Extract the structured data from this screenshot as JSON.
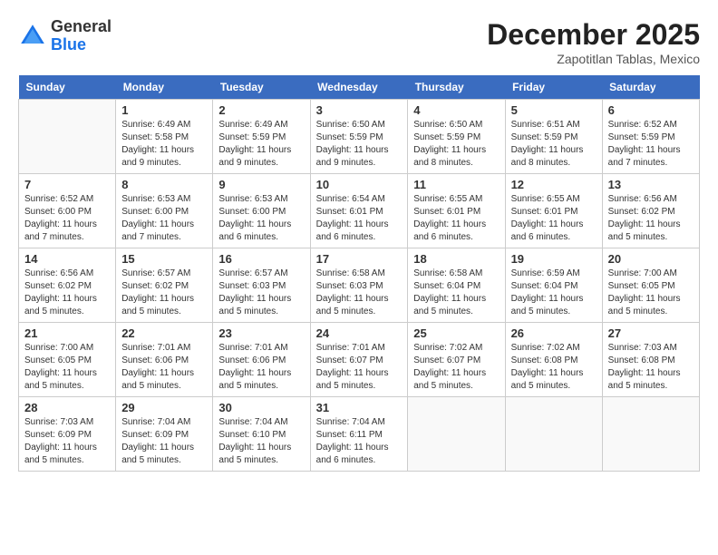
{
  "logo": {
    "general": "General",
    "blue": "Blue"
  },
  "title": "December 2025",
  "location": "Zapotitlan Tablas, Mexico",
  "days_header": [
    "Sunday",
    "Monday",
    "Tuesday",
    "Wednesday",
    "Thursday",
    "Friday",
    "Saturday"
  ],
  "weeks": [
    [
      {
        "day": "",
        "sunrise": "",
        "sunset": "",
        "daylight": ""
      },
      {
        "day": "1",
        "sunrise": "Sunrise: 6:49 AM",
        "sunset": "Sunset: 5:58 PM",
        "daylight": "Daylight: 11 hours and 9 minutes."
      },
      {
        "day": "2",
        "sunrise": "Sunrise: 6:49 AM",
        "sunset": "Sunset: 5:59 PM",
        "daylight": "Daylight: 11 hours and 9 minutes."
      },
      {
        "day": "3",
        "sunrise": "Sunrise: 6:50 AM",
        "sunset": "Sunset: 5:59 PM",
        "daylight": "Daylight: 11 hours and 9 minutes."
      },
      {
        "day": "4",
        "sunrise": "Sunrise: 6:50 AM",
        "sunset": "Sunset: 5:59 PM",
        "daylight": "Daylight: 11 hours and 8 minutes."
      },
      {
        "day": "5",
        "sunrise": "Sunrise: 6:51 AM",
        "sunset": "Sunset: 5:59 PM",
        "daylight": "Daylight: 11 hours and 8 minutes."
      },
      {
        "day": "6",
        "sunrise": "Sunrise: 6:52 AM",
        "sunset": "Sunset: 5:59 PM",
        "daylight": "Daylight: 11 hours and 7 minutes."
      }
    ],
    [
      {
        "day": "7",
        "sunrise": "Sunrise: 6:52 AM",
        "sunset": "Sunset: 6:00 PM",
        "daylight": "Daylight: 11 hours and 7 minutes."
      },
      {
        "day": "8",
        "sunrise": "Sunrise: 6:53 AM",
        "sunset": "Sunset: 6:00 PM",
        "daylight": "Daylight: 11 hours and 7 minutes."
      },
      {
        "day": "9",
        "sunrise": "Sunrise: 6:53 AM",
        "sunset": "Sunset: 6:00 PM",
        "daylight": "Daylight: 11 hours and 6 minutes."
      },
      {
        "day": "10",
        "sunrise": "Sunrise: 6:54 AM",
        "sunset": "Sunset: 6:01 PM",
        "daylight": "Daylight: 11 hours and 6 minutes."
      },
      {
        "day": "11",
        "sunrise": "Sunrise: 6:55 AM",
        "sunset": "Sunset: 6:01 PM",
        "daylight": "Daylight: 11 hours and 6 minutes."
      },
      {
        "day": "12",
        "sunrise": "Sunrise: 6:55 AM",
        "sunset": "Sunset: 6:01 PM",
        "daylight": "Daylight: 11 hours and 6 minutes."
      },
      {
        "day": "13",
        "sunrise": "Sunrise: 6:56 AM",
        "sunset": "Sunset: 6:02 PM",
        "daylight": "Daylight: 11 hours and 5 minutes."
      }
    ],
    [
      {
        "day": "14",
        "sunrise": "Sunrise: 6:56 AM",
        "sunset": "Sunset: 6:02 PM",
        "daylight": "Daylight: 11 hours and 5 minutes."
      },
      {
        "day": "15",
        "sunrise": "Sunrise: 6:57 AM",
        "sunset": "Sunset: 6:02 PM",
        "daylight": "Daylight: 11 hours and 5 minutes."
      },
      {
        "day": "16",
        "sunrise": "Sunrise: 6:57 AM",
        "sunset": "Sunset: 6:03 PM",
        "daylight": "Daylight: 11 hours and 5 minutes."
      },
      {
        "day": "17",
        "sunrise": "Sunrise: 6:58 AM",
        "sunset": "Sunset: 6:03 PM",
        "daylight": "Daylight: 11 hours and 5 minutes."
      },
      {
        "day": "18",
        "sunrise": "Sunrise: 6:58 AM",
        "sunset": "Sunset: 6:04 PM",
        "daylight": "Daylight: 11 hours and 5 minutes."
      },
      {
        "day": "19",
        "sunrise": "Sunrise: 6:59 AM",
        "sunset": "Sunset: 6:04 PM",
        "daylight": "Daylight: 11 hours and 5 minutes."
      },
      {
        "day": "20",
        "sunrise": "Sunrise: 7:00 AM",
        "sunset": "Sunset: 6:05 PM",
        "daylight": "Daylight: 11 hours and 5 minutes."
      }
    ],
    [
      {
        "day": "21",
        "sunrise": "Sunrise: 7:00 AM",
        "sunset": "Sunset: 6:05 PM",
        "daylight": "Daylight: 11 hours and 5 minutes."
      },
      {
        "day": "22",
        "sunrise": "Sunrise: 7:01 AM",
        "sunset": "Sunset: 6:06 PM",
        "daylight": "Daylight: 11 hours and 5 minutes."
      },
      {
        "day": "23",
        "sunrise": "Sunrise: 7:01 AM",
        "sunset": "Sunset: 6:06 PM",
        "daylight": "Daylight: 11 hours and 5 minutes."
      },
      {
        "day": "24",
        "sunrise": "Sunrise: 7:01 AM",
        "sunset": "Sunset: 6:07 PM",
        "daylight": "Daylight: 11 hours and 5 minutes."
      },
      {
        "day": "25",
        "sunrise": "Sunrise: 7:02 AM",
        "sunset": "Sunset: 6:07 PM",
        "daylight": "Daylight: 11 hours and 5 minutes."
      },
      {
        "day": "26",
        "sunrise": "Sunrise: 7:02 AM",
        "sunset": "Sunset: 6:08 PM",
        "daylight": "Daylight: 11 hours and 5 minutes."
      },
      {
        "day": "27",
        "sunrise": "Sunrise: 7:03 AM",
        "sunset": "Sunset: 6:08 PM",
        "daylight": "Daylight: 11 hours and 5 minutes."
      }
    ],
    [
      {
        "day": "28",
        "sunrise": "Sunrise: 7:03 AM",
        "sunset": "Sunset: 6:09 PM",
        "daylight": "Daylight: 11 hours and 5 minutes."
      },
      {
        "day": "29",
        "sunrise": "Sunrise: 7:04 AM",
        "sunset": "Sunset: 6:09 PM",
        "daylight": "Daylight: 11 hours and 5 minutes."
      },
      {
        "day": "30",
        "sunrise": "Sunrise: 7:04 AM",
        "sunset": "Sunset: 6:10 PM",
        "daylight": "Daylight: 11 hours and 5 minutes."
      },
      {
        "day": "31",
        "sunrise": "Sunrise: 7:04 AM",
        "sunset": "Sunset: 6:11 PM",
        "daylight": "Daylight: 11 hours and 6 minutes."
      },
      {
        "day": "",
        "sunrise": "",
        "sunset": "",
        "daylight": ""
      },
      {
        "day": "",
        "sunrise": "",
        "sunset": "",
        "daylight": ""
      },
      {
        "day": "",
        "sunrise": "",
        "sunset": "",
        "daylight": ""
      }
    ]
  ]
}
